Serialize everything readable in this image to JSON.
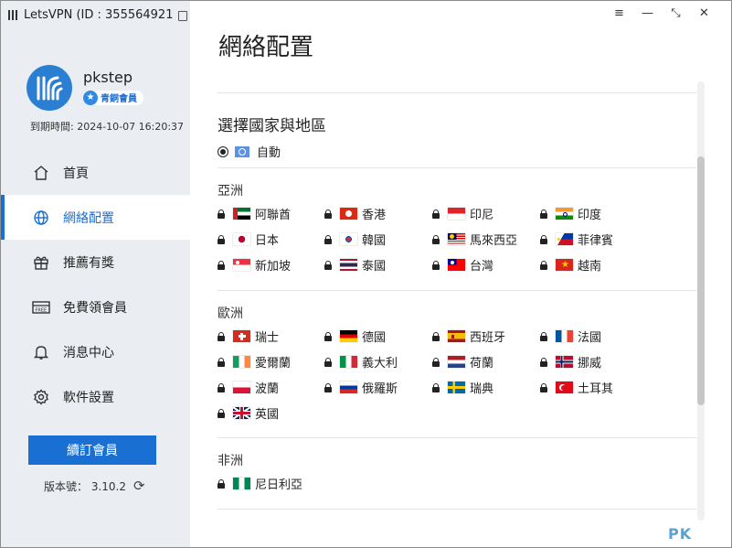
{
  "window": {
    "title": "LetsVPN (ID : 355564921",
    "title_suffix": ")",
    "controls": [
      "≡",
      "—",
      "⤡",
      "✕"
    ]
  },
  "sidebar": {
    "username": "pkstep",
    "badge": "青銅會員",
    "expiry": "到期時間: 2024-10-07 16:20:37",
    "nav": [
      {
        "label": "首頁",
        "icon": "home-icon"
      },
      {
        "label": "網絡配置",
        "icon": "globe-icon",
        "active": true
      },
      {
        "label": "推薦有獎",
        "icon": "gift-icon"
      },
      {
        "label": "免費領會員",
        "icon": "free-ticket-icon"
      },
      {
        "label": "消息中心",
        "icon": "bell-icon"
      },
      {
        "label": "軟件設置",
        "icon": "gear-icon"
      }
    ],
    "renew_button": "續訂會員",
    "version": "版本號： 3.10.2"
  },
  "main": {
    "title": "網絡配置",
    "select_title": "選擇國家與地區",
    "auto_label": "自動",
    "regions": [
      {
        "name": "亞洲",
        "countries": [
          {
            "name": "阿聯酋",
            "flag": "ae"
          },
          {
            "name": "香港",
            "flag": "hk"
          },
          {
            "name": "印尼",
            "flag": "id"
          },
          {
            "name": "印度",
            "flag": "in"
          },
          {
            "name": "日本",
            "flag": "jp"
          },
          {
            "name": "韓國",
            "flag": "kr"
          },
          {
            "name": "馬來西亞",
            "flag": "my"
          },
          {
            "name": "菲律賓",
            "flag": "ph"
          },
          {
            "name": "新加坡",
            "flag": "sg"
          },
          {
            "name": "泰國",
            "flag": "th"
          },
          {
            "name": "台灣",
            "flag": "tw"
          },
          {
            "name": "越南",
            "flag": "vn"
          }
        ]
      },
      {
        "name": "歐洲",
        "countries": [
          {
            "name": "瑞士",
            "flag": "ch"
          },
          {
            "name": "德國",
            "flag": "de"
          },
          {
            "name": "西班牙",
            "flag": "es"
          },
          {
            "name": "法國",
            "flag": "fr"
          },
          {
            "name": "愛爾蘭",
            "flag": "ie"
          },
          {
            "name": "義大利",
            "flag": "it"
          },
          {
            "name": "荷蘭",
            "flag": "nl"
          },
          {
            "name": "挪威",
            "flag": "no"
          },
          {
            "name": "波蘭",
            "flag": "pl"
          },
          {
            "name": "俄羅斯",
            "flag": "ru"
          },
          {
            "name": "瑞典",
            "flag": "se"
          },
          {
            "name": "土耳其",
            "flag": "tr"
          },
          {
            "name": "英國",
            "flag": "gb"
          }
        ]
      },
      {
        "name": "非洲",
        "countries": [
          {
            "name": "尼日利亞",
            "flag": "ng"
          }
        ]
      }
    ]
  },
  "watermark": "PK",
  "colors": {
    "accent": "#1a6fd3",
    "sidebar_bg": "#eaeef2",
    "avatar": "#2b7fd2"
  }
}
